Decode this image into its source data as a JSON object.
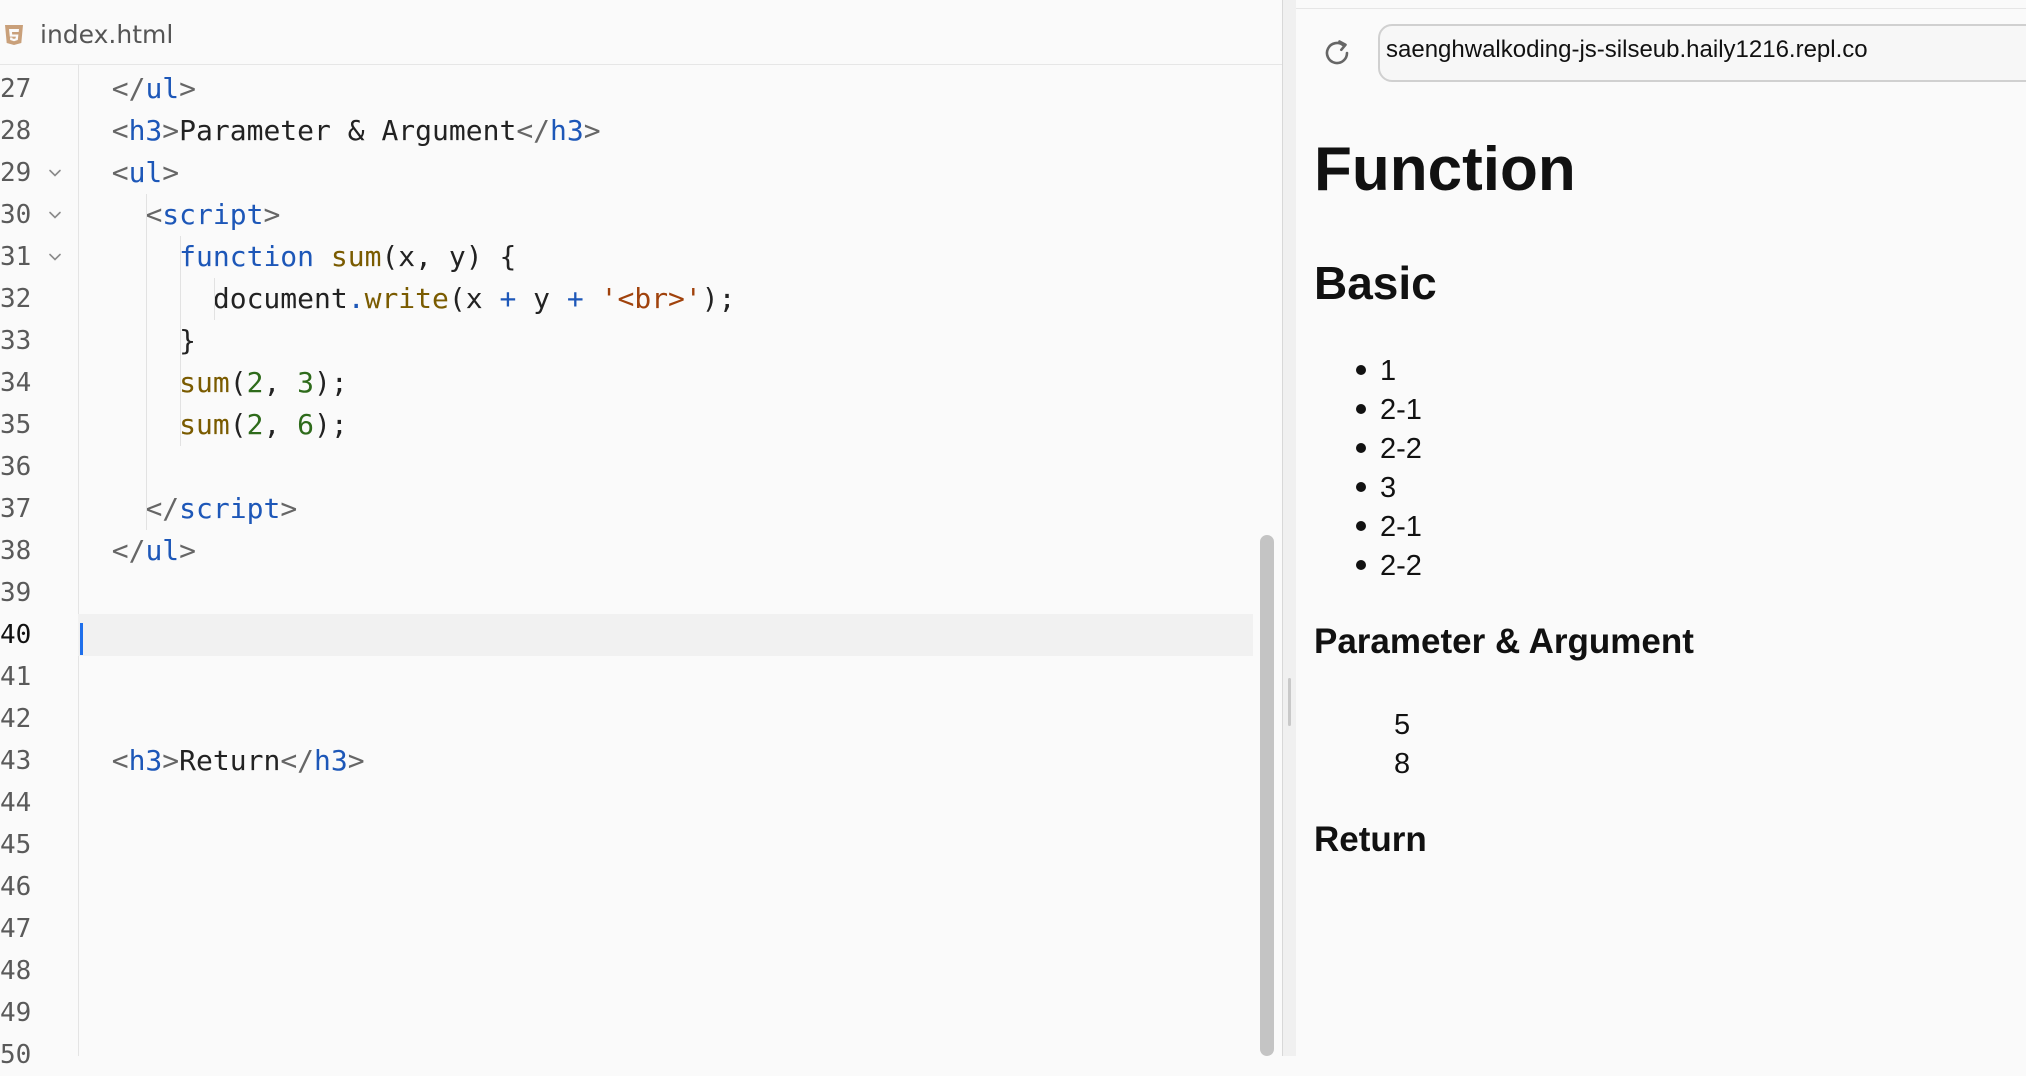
{
  "editor": {
    "tab": {
      "icon": "html5-icon",
      "label": "index.html"
    },
    "line_numbers": [
      "27",
      "28",
      "29",
      "30",
      "31",
      "32",
      "33",
      "34",
      "35",
      "36",
      "37",
      "38",
      "39",
      "40",
      "41",
      "42",
      "43",
      "44",
      "45",
      "46",
      "47",
      "48",
      "49",
      "50"
    ],
    "fold_lines": [
      "29",
      "30",
      "31"
    ],
    "active_line": "40",
    "lines": [
      [
        [
          "br",
          "</"
        ],
        [
          "tag",
          "ul"
        ],
        [
          "br",
          ">"
        ]
      ],
      [
        [
          "br",
          "<"
        ],
        [
          "tag",
          "h3"
        ],
        [
          "br",
          ">"
        ],
        [
          "txt",
          "Parameter & Argument"
        ],
        [
          "br",
          "</"
        ],
        [
          "tag",
          "h3"
        ],
        [
          "br",
          ">"
        ]
      ],
      [
        [
          "br",
          "<"
        ],
        [
          "tag",
          "ul"
        ],
        [
          "br",
          ">"
        ]
      ],
      [
        [
          "txt",
          "  "
        ],
        [
          "br",
          "<"
        ],
        [
          "tag",
          "script"
        ],
        [
          "br",
          ">"
        ]
      ],
      [
        [
          "txt",
          "    "
        ],
        [
          "kw",
          "function"
        ],
        [
          "txt",
          " "
        ],
        [
          "fn",
          "sum"
        ],
        [
          "txt",
          "(x, y) {"
        ]
      ],
      [
        [
          "txt",
          "      document"
        ],
        [
          "op",
          "."
        ],
        [
          "fn",
          "write"
        ],
        [
          "txt",
          "(x "
        ],
        [
          "op",
          "+"
        ],
        [
          "txt",
          " y "
        ],
        [
          "op",
          "+"
        ],
        [
          "txt",
          " "
        ],
        [
          "str",
          "'<br>'"
        ],
        [
          "txt",
          ");"
        ]
      ],
      [
        [
          "txt",
          "    }"
        ]
      ],
      [
        [
          "txt",
          "    "
        ],
        [
          "fn",
          "sum"
        ],
        [
          "txt",
          "("
        ],
        [
          "num",
          "2"
        ],
        [
          "txt",
          ", "
        ],
        [
          "num",
          "3"
        ],
        [
          "txt",
          ");"
        ]
      ],
      [
        [
          "txt",
          "    "
        ],
        [
          "fn",
          "sum"
        ],
        [
          "txt",
          "("
        ],
        [
          "num",
          "2"
        ],
        [
          "txt",
          ", "
        ],
        [
          "num",
          "6"
        ],
        [
          "txt",
          ");"
        ]
      ],
      [],
      [
        [
          "txt",
          "  "
        ],
        [
          "br",
          "</"
        ],
        [
          "tag",
          "script"
        ],
        [
          "br",
          ">"
        ]
      ],
      [
        [
          "br",
          "</"
        ],
        [
          "tag",
          "ul"
        ],
        [
          "br",
          ">"
        ]
      ],
      [],
      [],
      [],
      [],
      [
        [
          "br",
          "<"
        ],
        [
          "tag",
          "h3"
        ],
        [
          "br",
          ">"
        ],
        [
          "txt",
          "Return"
        ],
        [
          "br",
          "</"
        ],
        [
          "tag",
          "h3"
        ],
        [
          "br",
          ">"
        ]
      ],
      [],
      [],
      [],
      [],
      [],
      [],
      []
    ]
  },
  "preview": {
    "reload_icon": "reload-icon",
    "url": "saenghwalkoding-js-silseub.haily1216.repl.co",
    "h1": "Function",
    "h2": "Basic",
    "basic_items": [
      "1",
      "2-1",
      "2-2",
      "3",
      "2-1",
      "2-2"
    ],
    "param_heading": "Parameter & Argument",
    "param_output": [
      "5",
      "8"
    ],
    "return_heading": "Return"
  }
}
